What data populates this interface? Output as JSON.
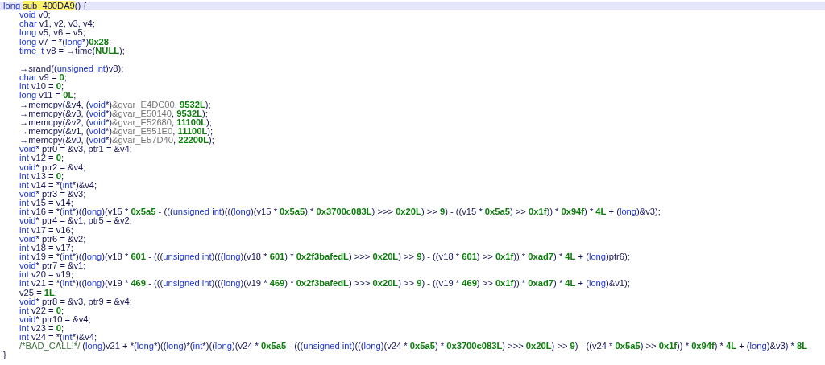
{
  "code": {
    "lines": [
      {
        "kind": "code",
        "selected": true,
        "tokens": [
          {
            "kind": "keyword",
            "text": "long"
          },
          {
            "kind": "highlight",
            "text": "sub_400DA9"
          },
          {
            "kind": "plain",
            "text": "() {"
          }
        ],
        "children": [
          {
            "kind": "code",
            "selected": false,
            "tokens": [
              {
                "kind": "keyword",
                "text": "void"
              },
              {
                "kind": "plain",
                "text": " v0;"
              }
            ]
          },
          {
            "kind": "code",
            "selected": false,
            "tokens": [
              {
                "kind": "keyword",
                "text": "char"
              },
              {
                "kind": "plain",
                "text": " v1, v2, v3, v4;"
              }
            ]
          },
          {
            "kind": "code",
            "selected": false,
            "tokens": [
              {
                "kind": "keyword",
                "text": "long"
              },
              {
                "kind": "plain",
                "text": " v5, v6 = v5;"
              }
            ]
          },
          {
            "kind": "code",
            "selected": false,
            "tokens": [
              {
                "kind": "keyword",
                "text": "long"
              },
              {
                "kind": "plain",
                "text": " v7 = *("
              },
              {
                "kind": "keyword",
                "text": "long"
              },
              {
                "kind": "plain",
                "text": "*)"
              },
              {
                "kind": "number",
                "text": "0x28"
              },
              {
                "kind": "plain",
                "text": ";"
              }
            ]
          },
          {
            "kind": "code",
            "selected": false,
            "tokens": [
              {
                "kind": "keyword",
                "text": "time_t"
              },
              {
                "kind": "plain",
                "text": " v8 = "
              },
              {
                "kind": "call",
                "text": "→time"
              },
              {
                "kind": "plain",
                "text": "("
              },
              {
                "kind": "number",
                "text": "NULL"
              },
              {
                "kind": "plain",
                "text": ");"
              }
            ]
          },
          {
            "kind": "blank",
            "selected": false
          },
          {
            "kind": "code",
            "selected": false,
            "tokens": [
              {
                "kind": "call",
                "text": "→srand"
              },
              {
                "kind": "plain",
                "text": "(("
              },
              {
                "kind": "keyword",
                "text": "unsigned int"
              },
              {
                "kind": "plain",
                "text": ")v8);"
              }
            ]
          },
          {
            "kind": "code",
            "selected": false,
            "tokens": [
              {
                "kind": "keyword",
                "text": "char"
              },
              {
                "kind": "plain",
                "text": " v9 = "
              },
              {
                "kind": "number",
                "text": "0"
              },
              {
                "kind": "plain",
                "text": ";"
              }
            ]
          },
          {
            "kind": "code",
            "selected": false,
            "tokens": [
              {
                "kind": "keyword",
                "text": "int"
              },
              {
                "kind": "plain",
                "text": " v10 = "
              },
              {
                "kind": "number",
                "text": "0"
              },
              {
                "kind": "plain",
                "text": ";"
              }
            ]
          },
          {
            "kind": "code",
            "selected": false,
            "tokens": [
              {
                "kind": "keyword",
                "text": "long"
              },
              {
                "kind": "plain",
                "text": " v11 = "
              },
              {
                "kind": "number",
                "text": "0L"
              },
              {
                "kind": "plain",
                "text": ";"
              }
            ]
          },
          {
            "kind": "code",
            "selected": false,
            "tokens": [
              {
                "kind": "call",
                "text": "→memcpy"
              },
              {
                "kind": "plain",
                "text": "(&v4, ("
              },
              {
                "kind": "keyword",
                "text": "void"
              },
              {
                "kind": "plain",
                "text": "*)"
              },
              {
                "kind": "global",
                "text": "&gvar_E4DC00"
              },
              {
                "kind": "plain",
                "text": ", "
              },
              {
                "kind": "number",
                "text": "9532L"
              },
              {
                "kind": "plain",
                "text": ");"
              }
            ]
          },
          {
            "kind": "code",
            "selected": false,
            "tokens": [
              {
                "kind": "call",
                "text": "→memcpy"
              },
              {
                "kind": "plain",
                "text": "(&v3, ("
              },
              {
                "kind": "keyword",
                "text": "void"
              },
              {
                "kind": "plain",
                "text": "*)"
              },
              {
                "kind": "global",
                "text": "&gvar_E50140"
              },
              {
                "kind": "plain",
                "text": ", "
              },
              {
                "kind": "number",
                "text": "9532L"
              },
              {
                "kind": "plain",
                "text": ");"
              }
            ]
          },
          {
            "kind": "code",
            "selected": false,
            "tokens": [
              {
                "kind": "call",
                "text": "→memcpy"
              },
              {
                "kind": "plain",
                "text": "(&v2, ("
              },
              {
                "kind": "keyword",
                "text": "void"
              },
              {
                "kind": "plain",
                "text": "*)"
              },
              {
                "kind": "global",
                "text": "&gvar_E52680"
              },
              {
                "kind": "plain",
                "text": ", "
              },
              {
                "kind": "number",
                "text": "11100L"
              },
              {
                "kind": "plain",
                "text": ");"
              }
            ]
          },
          {
            "kind": "code",
            "selected": false,
            "tokens": [
              {
                "kind": "call",
                "text": "→memcpy"
              },
              {
                "kind": "plain",
                "text": "(&v1, ("
              },
              {
                "kind": "keyword",
                "text": "void"
              },
              {
                "kind": "plain",
                "text": "*)"
              },
              {
                "kind": "global",
                "text": "&gvar_E551E0"
              },
              {
                "kind": "plain",
                "text": ", "
              },
              {
                "kind": "number",
                "text": "11100L"
              },
              {
                "kind": "plain",
                "text": ");"
              }
            ]
          },
          {
            "kind": "code",
            "selected": false,
            "tokens": [
              {
                "kind": "call",
                "text": "→memcpy"
              },
              {
                "kind": "plain",
                "text": "(&v0, ("
              },
              {
                "kind": "keyword",
                "text": "void"
              },
              {
                "kind": "plain",
                "text": "*)"
              },
              {
                "kind": "global",
                "text": "&gvar_E57D40"
              },
              {
                "kind": "plain",
                "text": ", "
              },
              {
                "kind": "number",
                "text": "22200L"
              },
              {
                "kind": "plain",
                "text": ");"
              }
            ]
          },
          {
            "kind": "code",
            "selected": false,
            "tokens": [
              {
                "kind": "keyword",
                "text": "void"
              },
              {
                "kind": "plain",
                "text": "* ptr0 = &v3, ptr1 = &v4;"
              }
            ]
          },
          {
            "kind": "code",
            "selected": false,
            "tokens": [
              {
                "kind": "keyword",
                "text": "int"
              },
              {
                "kind": "plain",
                "text": " v12 = "
              },
              {
                "kind": "number",
                "text": "0"
              },
              {
                "kind": "plain",
                "text": ";"
              }
            ]
          },
          {
            "kind": "code",
            "selected": false,
            "tokens": [
              {
                "kind": "keyword",
                "text": "void"
              },
              {
                "kind": "plain",
                "text": "* ptr2 = &v4;"
              }
            ]
          },
          {
            "kind": "code",
            "selected": false,
            "tokens": [
              {
                "kind": "keyword",
                "text": "int"
              },
              {
                "kind": "plain",
                "text": " v13 = "
              },
              {
                "kind": "number",
                "text": "0"
              },
              {
                "kind": "plain",
                "text": ";"
              }
            ]
          },
          {
            "kind": "code",
            "selected": false,
            "tokens": [
              {
                "kind": "keyword",
                "text": "int"
              },
              {
                "kind": "plain",
                "text": " v14 = *("
              },
              {
                "kind": "keyword",
                "text": "int"
              },
              {
                "kind": "plain",
                "text": "*)&v4;"
              }
            ]
          },
          {
            "kind": "code",
            "selected": false,
            "tokens": [
              {
                "kind": "keyword",
                "text": "void"
              },
              {
                "kind": "plain",
                "text": "* ptr3 = &v3;"
              }
            ]
          },
          {
            "kind": "code",
            "selected": false,
            "tokens": [
              {
                "kind": "keyword",
                "text": "int"
              },
              {
                "kind": "plain",
                "text": " v15 = v14;"
              }
            ]
          },
          {
            "kind": "code",
            "selected": false,
            "tokens": [
              {
                "kind": "keyword",
                "text": "int"
              },
              {
                "kind": "plain",
                "text": " v16 = *("
              },
              {
                "kind": "keyword",
                "text": "int"
              },
              {
                "kind": "plain",
                "text": "*)(("
              },
              {
                "kind": "keyword",
                "text": "long"
              },
              {
                "kind": "plain",
                "text": ")(v15 * "
              },
              {
                "kind": "number",
                "text": "0x5a5"
              },
              {
                "kind": "plain",
                "text": " - ((("
              },
              {
                "kind": "keyword",
                "text": "unsigned int"
              },
              {
                "kind": "plain",
                "text": ")((("
              },
              {
                "kind": "keyword",
                "text": "long"
              },
              {
                "kind": "plain",
                "text": ")(v15 * "
              },
              {
                "kind": "number",
                "text": "0x5a5"
              },
              {
                "kind": "plain",
                "text": ") * "
              },
              {
                "kind": "number",
                "text": "0x3700c083L"
              },
              {
                "kind": "plain",
                "text": ") >>> "
              },
              {
                "kind": "number",
                "text": "0x20L"
              },
              {
                "kind": "plain",
                "text": ") >> "
              },
              {
                "kind": "number",
                "text": "9"
              },
              {
                "kind": "plain",
                "text": ") - ((v15 * "
              },
              {
                "kind": "number",
                "text": "0x5a5"
              },
              {
                "kind": "plain",
                "text": ") >> "
              },
              {
                "kind": "number",
                "text": "0x1f"
              },
              {
                "kind": "plain",
                "text": ")) * "
              },
              {
                "kind": "number",
                "text": "0x94f"
              },
              {
                "kind": "plain",
                "text": ") * "
              },
              {
                "kind": "number",
                "text": "4L"
              },
              {
                "kind": "plain",
                "text": " + ("
              },
              {
                "kind": "keyword",
                "text": "long"
              },
              {
                "kind": "plain",
                "text": ")&v3);"
              }
            ]
          },
          {
            "kind": "code",
            "selected": false,
            "tokens": [
              {
                "kind": "keyword",
                "text": "void"
              },
              {
                "kind": "plain",
                "text": "* ptr4 = &v1, ptr5 = &v2;"
              }
            ]
          },
          {
            "kind": "code",
            "selected": false,
            "tokens": [
              {
                "kind": "keyword",
                "text": "int"
              },
              {
                "kind": "plain",
                "text": " v17 = v16;"
              }
            ]
          },
          {
            "kind": "code",
            "selected": false,
            "tokens": [
              {
                "kind": "keyword",
                "text": "void"
              },
              {
                "kind": "plain",
                "text": "* ptr6 = &v2;"
              }
            ]
          },
          {
            "kind": "code",
            "selected": false,
            "tokens": [
              {
                "kind": "keyword",
                "text": "int"
              },
              {
                "kind": "plain",
                "text": " v18 = v17;"
              }
            ]
          },
          {
            "kind": "code",
            "selected": false,
            "tokens": [
              {
                "kind": "keyword",
                "text": "int"
              },
              {
                "kind": "plain",
                "text": " v19 = *("
              },
              {
                "kind": "keyword",
                "text": "int"
              },
              {
                "kind": "plain",
                "text": "*)(("
              },
              {
                "kind": "keyword",
                "text": "long"
              },
              {
                "kind": "plain",
                "text": ")(v18 * "
              },
              {
                "kind": "number",
                "text": "601"
              },
              {
                "kind": "plain",
                "text": " - ((("
              },
              {
                "kind": "keyword",
                "text": "unsigned int"
              },
              {
                "kind": "plain",
                "text": ")((("
              },
              {
                "kind": "keyword",
                "text": "long"
              },
              {
                "kind": "plain",
                "text": ")(v18 * "
              },
              {
                "kind": "number",
                "text": "601"
              },
              {
                "kind": "plain",
                "text": ") * "
              },
              {
                "kind": "number",
                "text": "0x2f3bafedL"
              },
              {
                "kind": "plain",
                "text": ") >>> "
              },
              {
                "kind": "number",
                "text": "0x20L"
              },
              {
                "kind": "plain",
                "text": ") >> "
              },
              {
                "kind": "number",
                "text": "9"
              },
              {
                "kind": "plain",
                "text": ") - ((v18 * "
              },
              {
                "kind": "number",
                "text": "601"
              },
              {
                "kind": "plain",
                "text": ") >> "
              },
              {
                "kind": "number",
                "text": "0x1f"
              },
              {
                "kind": "plain",
                "text": ")) * "
              },
              {
                "kind": "number",
                "text": "0xad7"
              },
              {
                "kind": "plain",
                "text": ") * "
              },
              {
                "kind": "number",
                "text": "4L"
              },
              {
                "kind": "plain",
                "text": " + ("
              },
              {
                "kind": "keyword",
                "text": "long"
              },
              {
                "kind": "plain",
                "text": ")ptr6);"
              }
            ]
          },
          {
            "kind": "code",
            "selected": false,
            "tokens": [
              {
                "kind": "keyword",
                "text": "void"
              },
              {
                "kind": "plain",
                "text": "* ptr7 = &v1;"
              }
            ]
          },
          {
            "kind": "code",
            "selected": false,
            "tokens": [
              {
                "kind": "keyword",
                "text": "int"
              },
              {
                "kind": "plain",
                "text": " v20 = v19;"
              }
            ]
          },
          {
            "kind": "code",
            "selected": false,
            "tokens": [
              {
                "kind": "keyword",
                "text": "int"
              },
              {
                "kind": "plain",
                "text": " v21 = *("
              },
              {
                "kind": "keyword",
                "text": "int"
              },
              {
                "kind": "plain",
                "text": "*)(("
              },
              {
                "kind": "keyword",
                "text": "long"
              },
              {
                "kind": "plain",
                "text": ")(v19 * "
              },
              {
                "kind": "number",
                "text": "469"
              },
              {
                "kind": "plain",
                "text": " - ((("
              },
              {
                "kind": "keyword",
                "text": "unsigned int"
              },
              {
                "kind": "plain",
                "text": ")((("
              },
              {
                "kind": "keyword",
                "text": "long"
              },
              {
                "kind": "plain",
                "text": ")(v19 * "
              },
              {
                "kind": "number",
                "text": "469"
              },
              {
                "kind": "plain",
                "text": ") * "
              },
              {
                "kind": "number",
                "text": "0x2f3bafedL"
              },
              {
                "kind": "plain",
                "text": ") >>> "
              },
              {
                "kind": "number",
                "text": "0x20L"
              },
              {
                "kind": "plain",
                "text": ") >> "
              },
              {
                "kind": "number",
                "text": "9"
              },
              {
                "kind": "plain",
                "text": ") - ((v19 * "
              },
              {
                "kind": "number",
                "text": "469"
              },
              {
                "kind": "plain",
                "text": ") >> "
              },
              {
                "kind": "number",
                "text": "0x1f"
              },
              {
                "kind": "plain",
                "text": ")) * "
              },
              {
                "kind": "number",
                "text": "0xad7"
              },
              {
                "kind": "plain",
                "text": ") * "
              },
              {
                "kind": "number",
                "text": "4L"
              },
              {
                "kind": "plain",
                "text": " + ("
              },
              {
                "kind": "keyword",
                "text": "long"
              },
              {
                "kind": "plain",
                "text": ")&v1);"
              }
            ]
          },
          {
            "kind": "code",
            "selected": false,
            "tokens": [
              {
                "kind": "plain",
                "text": "v25 = "
              },
              {
                "kind": "number",
                "text": "1L"
              },
              {
                "kind": "plain",
                "text": ";"
              }
            ]
          },
          {
            "kind": "code",
            "selected": false,
            "tokens": [
              {
                "kind": "keyword",
                "text": "void"
              },
              {
                "kind": "plain",
                "text": "* ptr8 = &v3, ptr9 = &v4;"
              }
            ]
          },
          {
            "kind": "code",
            "selected": false,
            "tokens": [
              {
                "kind": "keyword",
                "text": "int"
              },
              {
                "kind": "plain",
                "text": " v22 = "
              },
              {
                "kind": "number",
                "text": "0"
              },
              {
                "kind": "plain",
                "text": ";"
              }
            ]
          },
          {
            "kind": "code",
            "selected": false,
            "tokens": [
              {
                "kind": "keyword",
                "text": "void"
              },
              {
                "kind": "plain",
                "text": "* ptr10 = &v4;"
              }
            ]
          },
          {
            "kind": "code",
            "selected": false,
            "tokens": [
              {
                "kind": "keyword",
                "text": "int"
              },
              {
                "kind": "plain",
                "text": " v23 = "
              },
              {
                "kind": "number",
                "text": "0"
              },
              {
                "kind": "plain",
                "text": ";"
              }
            ]
          },
          {
            "kind": "code",
            "selected": false,
            "tokens": [
              {
                "kind": "keyword",
                "text": "int"
              },
              {
                "kind": "plain",
                "text": " v24 = *("
              },
              {
                "kind": "keyword",
                "text": "int"
              },
              {
                "kind": "plain",
                "text": "*)&v4;"
              }
            ]
          },
          {
            "kind": "code",
            "selected": false,
            "tokens": [
              {
                "kind": "comment",
                "text": "/*BAD_CALL!*/"
              },
              {
                "kind": "plain",
                "text": " ("
              },
              {
                "kind": "keyword",
                "text": "long"
              },
              {
                "kind": "plain",
                "text": ")v21 + *("
              },
              {
                "kind": "keyword",
                "text": "long"
              },
              {
                "kind": "plain",
                "text": "*)(("
              },
              {
                "kind": "keyword",
                "text": "long"
              },
              {
                "kind": "plain",
                "text": ")*("
              },
              {
                "kind": "keyword",
                "text": "int"
              },
              {
                "kind": "plain",
                "text": "*)(("
              },
              {
                "kind": "keyword",
                "text": "long"
              },
              {
                "kind": "plain",
                "text": ")(v24 * "
              },
              {
                "kind": "number",
                "text": "0x5a5"
              },
              {
                "kind": "plain",
                "text": " - ((("
              },
              {
                "kind": "keyword",
                "text": "unsigned int"
              },
              {
                "kind": "plain",
                "text": ")((("
              },
              {
                "kind": "keyword",
                "text": "long"
              },
              {
                "kind": "plain",
                "text": ")(v24 * "
              },
              {
                "kind": "number",
                "text": "0x5a5"
              },
              {
                "kind": "plain",
                "text": ") * "
              },
              {
                "kind": "number",
                "text": "0x3700c083L"
              },
              {
                "kind": "plain",
                "text": ") >>> "
              },
              {
                "kind": "number",
                "text": "0x20L"
              },
              {
                "kind": "plain",
                "text": ") >> "
              },
              {
                "kind": "number",
                "text": "9"
              },
              {
                "kind": "plain",
                "text": ") - ((v24 * "
              },
              {
                "kind": "number",
                "text": "0x5a5"
              },
              {
                "kind": "plain",
                "text": ") >> "
              },
              {
                "kind": "number",
                "text": "0x1f"
              },
              {
                "kind": "plain",
                "text": ")) * "
              },
              {
                "kind": "number",
                "text": "0x94f"
              },
              {
                "kind": "plain",
                "text": ") * "
              },
              {
                "kind": "number",
                "text": "4L"
              },
              {
                "kind": "plain",
                "text": " + ("
              },
              {
                "kind": "keyword",
                "text": "long"
              },
              {
                "kind": "plain",
                "text": ")&v3) * "
              },
              {
                "kind": "number",
                "text": "8L"
              }
            ]
          }
        ]
      },
      {
        "kind": "code",
        "selected": false,
        "tokens": [
          {
            "kind": "plain",
            "text": "}"
          }
        ]
      }
    ]
  }
}
